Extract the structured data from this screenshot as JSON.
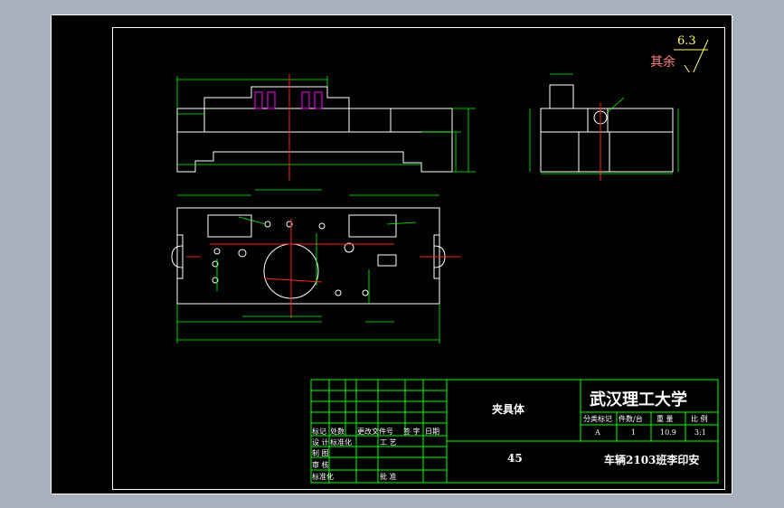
{
  "roughness": {
    "value": "6.3",
    "label": "其余"
  },
  "title_block": {
    "part_name": "夹具体",
    "university": "武汉理工大学",
    "material": "45",
    "designer_line": "车辆2103班李印安",
    "headers": {
      "stage_mark": "分类标记",
      "weight_label": "件数/台",
      "mass_label": "重  量",
      "scale_label": "比 例"
    },
    "values": {
      "stage_mark": "A",
      "count": "1",
      "mass": "10.9",
      "scale": "3:1"
    },
    "left_rows": {
      "row1": [
        "标记",
        "处数",
        "更改文件号",
        "签  字",
        "日期"
      ],
      "design": "设  计",
      "standard": "标准化",
      "craft": "工  艺",
      "drawing": "制  图",
      "check": "审  核",
      "normalization": "标准化",
      "approve": "批  准"
    }
  }
}
